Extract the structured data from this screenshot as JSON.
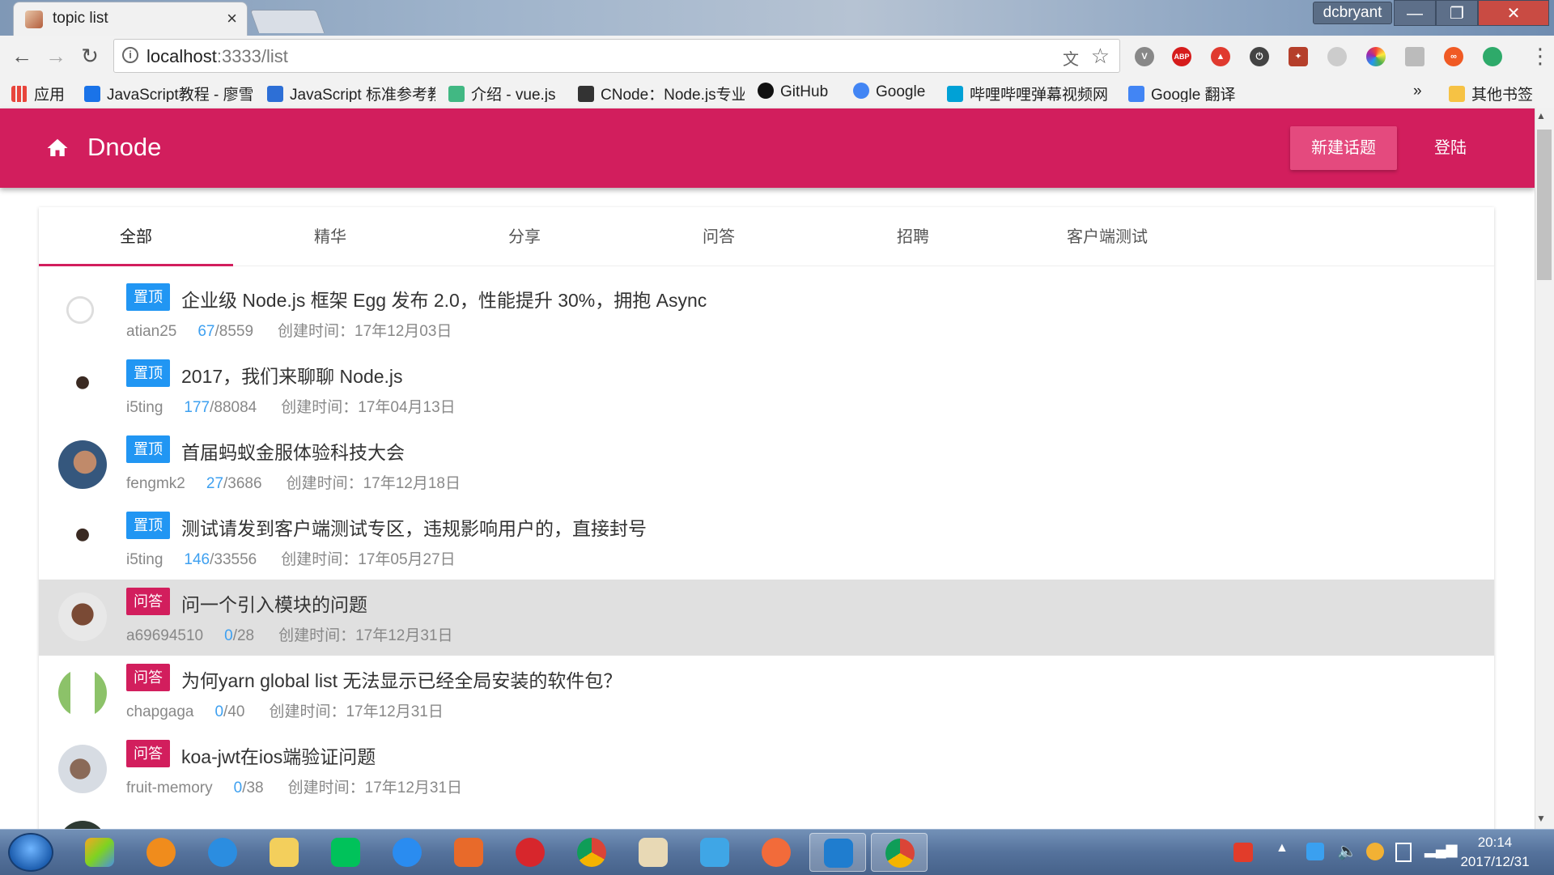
{
  "browser": {
    "tab_title": "topic list",
    "tab_close": "×",
    "user_badge": "dcbryant",
    "url_host": "localhost",
    "url_path": ":3333/list",
    "bookmarks": [
      {
        "label": "应用",
        "color": "#e8453c"
      },
      {
        "label": "JavaScript教程 - 廖雪峰",
        "color": "#1a73e8"
      },
      {
        "label": "JavaScript 标准参考教程",
        "color": "#2d6fd6"
      },
      {
        "label": "介绍 - vue.js",
        "color": "#41b883"
      },
      {
        "label": "CNode：Node.js专业中文社区",
        "color": "#333333"
      },
      {
        "label": "GitHub",
        "color": "#111111"
      },
      {
        "label": "Google",
        "color": "#4285f4"
      },
      {
        "label": "哔哩哔哩弹幕视频网",
        "color": "#00a1d6"
      },
      {
        "label": "Google 翻译",
        "color": "#4285f4"
      }
    ],
    "bookmarks_more": "»",
    "other_bookmarks": "其他书签"
  },
  "app": {
    "brand": "Dnode",
    "new_topic": "新建话题",
    "login": "登陆"
  },
  "tabs": [
    "全部",
    "精华",
    "分享",
    "问答",
    "招聘",
    "客户端测试"
  ],
  "topics": [
    {
      "badge": "置顶",
      "title": "企业级 Node.js 框架 Egg 发布 2.0，性能提升 30%，拥抱 Async",
      "author": "atian25",
      "reply": "67",
      "visit": "/8559",
      "created": "创建时间：17年12月03日"
    },
    {
      "badge": "置顶",
      "title": "2017，我们来聊聊 Node.js",
      "author": "i5ting",
      "reply": "177",
      "visit": "/88084",
      "created": "创建时间：17年04月13日"
    },
    {
      "badge": "置顶",
      "title": "首届蚂蚁金服体验科技大会",
      "author": "fengmk2",
      "reply": "27",
      "visit": "/3686",
      "created": "创建时间：17年12月18日"
    },
    {
      "badge": "置顶",
      "title": "测试请发到客户端测试专区，违规影响用户的，直接封号",
      "author": "i5ting",
      "reply": "146",
      "visit": "/33556",
      "created": "创建时间：17年05月27日"
    },
    {
      "badge": "问答",
      "title": "问一个引入模块的问题",
      "author": "a69694510",
      "reply": "0",
      "visit": "/28",
      "created": "创建时间：17年12月31日"
    },
    {
      "badge": "问答",
      "title": "为何yarn global list 无法显示已经全局安装的软件包？",
      "author": "chapgaga",
      "reply": "0",
      "visit": "/40",
      "created": "创建时间：17年12月31日"
    },
    {
      "badge": "问答",
      "title": "koa-jwt在ios端验证问题",
      "author": "fruit-memory",
      "reply": "0",
      "visit": "/38",
      "created": "创建时间：17年12月31日"
    }
  ],
  "taskbar": {
    "time": "20:14",
    "date": "2017/12/31"
  }
}
